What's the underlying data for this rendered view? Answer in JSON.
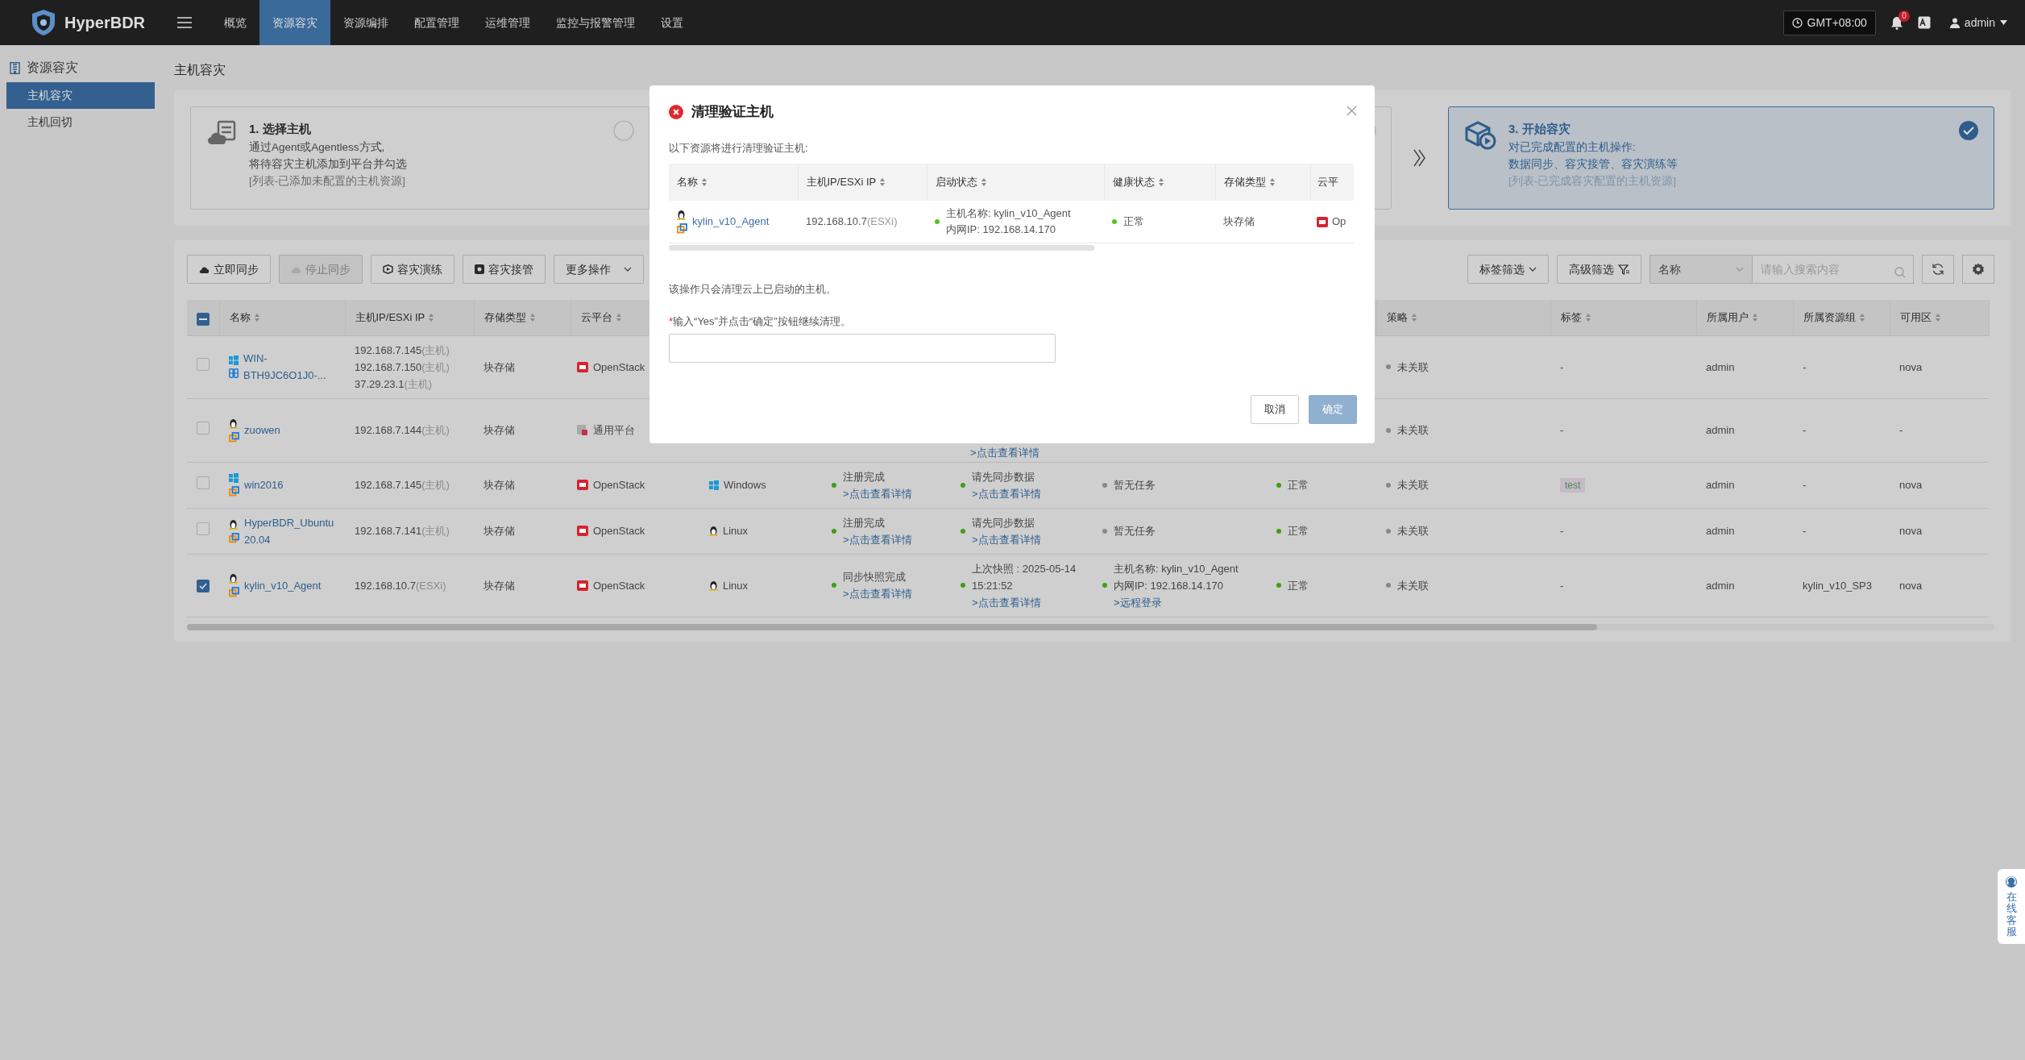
{
  "header": {
    "logo": "HyperBDR",
    "nav": [
      {
        "label": "概览",
        "selected": false
      },
      {
        "label": "资源容灾",
        "selected": true
      },
      {
        "label": "资源编排",
        "selected": false
      },
      {
        "label": "配置管理",
        "selected": false
      },
      {
        "label": "运维管理",
        "selected": false
      },
      {
        "label": "监控与报警管理",
        "selected": false
      },
      {
        "label": "设置",
        "selected": false
      }
    ],
    "timezone": "GMT+08:00",
    "notification_count": "0",
    "user": "admin"
  },
  "sidebar": {
    "title": "资源容灾",
    "items": [
      {
        "label": "主机容灾",
        "selected": true
      },
      {
        "label": "主机回切",
        "selected": false
      }
    ]
  },
  "page_title": "主机容灾",
  "steps": [
    {
      "kind": "select",
      "title": "1. 选择主机",
      "description": [
        "通过Agent或Agentless方式,",
        "将待容灾主机添加到平台并勾选"
      ],
      "note": "[列表-已添加未配置的主机资源]",
      "selected": false
    },
    {
      "kind": "config",
      "selected": false
    },
    {
      "kind": "start",
      "title": "3. 开始容灾",
      "description": [
        "对已完成配置的主机操作:",
        "数据同步、容灾接管、容灾演练等"
      ],
      "note": "[列表-已完成容灾配置的主机资源]",
      "selected": true
    }
  ],
  "toolbar": {
    "actions": [
      {
        "kind": "sync",
        "label": "立即同步",
        "disabled": false
      },
      {
        "kind": "stop",
        "label": "停止同步",
        "disabled": true
      },
      {
        "kind": "drill",
        "label": "容灾演练",
        "disabled": false
      },
      {
        "kind": "takeover",
        "label": "容灾接管",
        "disabled": false
      }
    ],
    "more": "更多操作",
    "tag_filter": "标签筛选",
    "advanced_filter": "高级筛选",
    "search_field": "名称",
    "search": {
      "placeholder": "请输入搜索内容"
    }
  },
  "table": {
    "header_checkbox": {
      "indeterminate": true
    },
    "columns": [
      "名称",
      "主机IP/ESXi IP",
      "存储类型",
      "云平台",
      null,
      null,
      null,
      null,
      null,
      "策略",
      "标签",
      "所属用户",
      "所属资源组",
      "可用区"
    ],
    "rows": [
      {
        "checked": false,
        "name": {
          "text": "WIN-BTH9JC6O1J0-...",
          "icons": [
            {
              "kind": "windows"
            },
            {
              "kind": "server"
            }
          ]
        },
        "ip": [
          {
            "ip": "192.168.7.145",
            "note": "(主机)"
          },
          {
            "ip": "192.168.7.150",
            "note": "(主机)"
          },
          {
            "ip": "37.29.23.1",
            "note": "(主机)"
          }
        ],
        "storage": "块存储",
        "cloud": {
          "kind": "openstack",
          "text": "OpenStack"
        },
        "strategy": {
          "text": "未关联",
          "color": "#888888"
        },
        "tag": {
          "kind": "plain",
          "text": "-"
        },
        "user": "admin",
        "group": "-",
        "zone": "nova"
      },
      {
        "checked": false,
        "name": {
          "text": "zuowen",
          "icons": [
            {
              "kind": "linux"
            },
            {
              "kind": "vmware"
            }
          ]
        },
        "ip": [
          {
            "ip": "192.168.7.144",
            "note": "(主机)"
          }
        ],
        "storage": "块存储",
        "cloud": {
          "kind": "generic",
          "text": "通用平台"
        },
        "sync": {
          "link": ">点击查看详情"
        },
        "strategy": {
          "text": "未关联",
          "color": "#888888"
        },
        "tag": {
          "kind": "plain",
          "text": "-"
        },
        "user": "admin",
        "group": "-",
        "zone": "-"
      },
      {
        "checked": false,
        "name": {
          "text": "win2016",
          "icons": [
            {
              "kind": "windows"
            },
            {
              "kind": "vmware"
            }
          ]
        },
        "ip": [
          {
            "ip": "192.168.7.145",
            "note": "(主机)"
          }
        ],
        "storage": "块存储",
        "cloud": {
          "kind": "openstack",
          "text": "OpenStack"
        },
        "os": {
          "kind": "windows",
          "text": "Windows"
        },
        "register": {
          "text": "注册完成",
          "link": ">点击查看详情",
          "color": "#429d15"
        },
        "sync": {
          "text": "请先同步数据",
          "link": ">点击查看详情",
          "color": "#429d15"
        },
        "host": {
          "lines": [
            "暂无任务"
          ],
          "color": "#888888"
        },
        "health": {
          "text": "正常",
          "color": "#429d15"
        },
        "strategy": {
          "text": "未关联",
          "color": "#888888"
        },
        "tag": {
          "kind": "badge",
          "text": "test"
        },
        "user": "admin",
        "group": "-",
        "zone": "nova"
      },
      {
        "checked": false,
        "name": {
          "text": "HyperBDR_Ubuntu20.04",
          "icons": [
            {
              "kind": "linux"
            },
            {
              "kind": "vmware"
            }
          ]
        },
        "ip": [
          {
            "ip": "192.168.7.141",
            "note": "(主机)"
          }
        ],
        "storage": "块存储",
        "cloud": {
          "kind": "openstack",
          "text": "OpenStack"
        },
        "os": {
          "kind": "linux",
          "text": "Linux"
        },
        "register": {
          "text": "注册完成",
          "link": ">点击查看详情",
          "color": "#429d15"
        },
        "sync": {
          "text": "请先同步数据",
          "link": ">点击查看详情",
          "color": "#429d15"
        },
        "host": {
          "lines": [
            "暂无任务"
          ],
          "color": "#888888"
        },
        "health": {
          "text": "正常",
          "color": "#429d15"
        },
        "strategy": {
          "text": "未关联",
          "color": "#888888"
        },
        "tag": {
          "kind": "plain",
          "text": "-"
        },
        "user": "admin",
        "group": "-",
        "zone": "nova"
      },
      {
        "checked": true,
        "name": {
          "text": "kylin_v10_Agent",
          "icons": [
            {
              "kind": "linux"
            },
            {
              "kind": "vmware"
            }
          ]
        },
        "ip": [
          {
            "ip": "192.168.10.7",
            "note": "(ESXi)"
          }
        ],
        "storage": "块存储",
        "cloud": {
          "kind": "openstack",
          "text": "OpenStack"
        },
        "os": {
          "kind": "linux",
          "text": "Linux"
        },
        "register": {
          "text": "同步快照完成",
          "link": ">点击查看详情",
          "color": "#429d15"
        },
        "sync": {
          "text": "上次快照 : 2025-05-14 15:21:52",
          "link": ">点击查看详情",
          "color": "#429d15"
        },
        "host": {
          "lines": [
            "主机名称: kylin_v10_Agent",
            "内网IP: 192.168.14.170"
          ],
          "link": ">远程登录",
          "color": "#429d15"
        },
        "health": {
          "text": "正常",
          "color": "#429d15"
        },
        "strategy": {
          "text": "未关联",
          "color": "#888888"
        },
        "tag": {
          "kind": "plain",
          "text": "-"
        },
        "user": "admin",
        "group": "kylin_v10_SP3",
        "zone": "nova"
      }
    ]
  },
  "modal": {
    "title": "清理验证主机",
    "intro": "以下资源将进行清理验证主机:",
    "columns": [
      "名称",
      "主机IP/ESXi IP",
      "启动状态",
      "健康状态",
      "存储类型",
      "云平"
    ],
    "row": {
      "name": {
        "text": "kylin_v10_Agent",
        "icons": [
          {
            "kind": "linux"
          },
          {
            "kind": "vmware"
          }
        ]
      },
      "ip": {
        "ip": "192.168.10.7",
        "note": "(ESXi)"
      },
      "boot": {
        "lines": [
          "主机名称: kylin_v10_Agent",
          "内网IP: 192.168.14.170"
        ],
        "color": "#52c41a"
      },
      "health": {
        "text": "正常",
        "color": "#52c41a"
      },
      "storage": "块存储",
      "cloud": {
        "kind": "openstack",
        "text": "Op"
      }
    },
    "warning": "该操作只会清理云上已启动的主机。",
    "required_mark": "*",
    "prompt": "输入“Yes”并点击“确定”按钮继续清理。",
    "buttons": [
      {
        "label": "取消",
        "kind": "cancel",
        "disabled": false
      },
      {
        "label": "确定",
        "kind": "primary",
        "disabled": true
      }
    ]
  },
  "service_widget": {
    "label": "在线客服"
  }
}
